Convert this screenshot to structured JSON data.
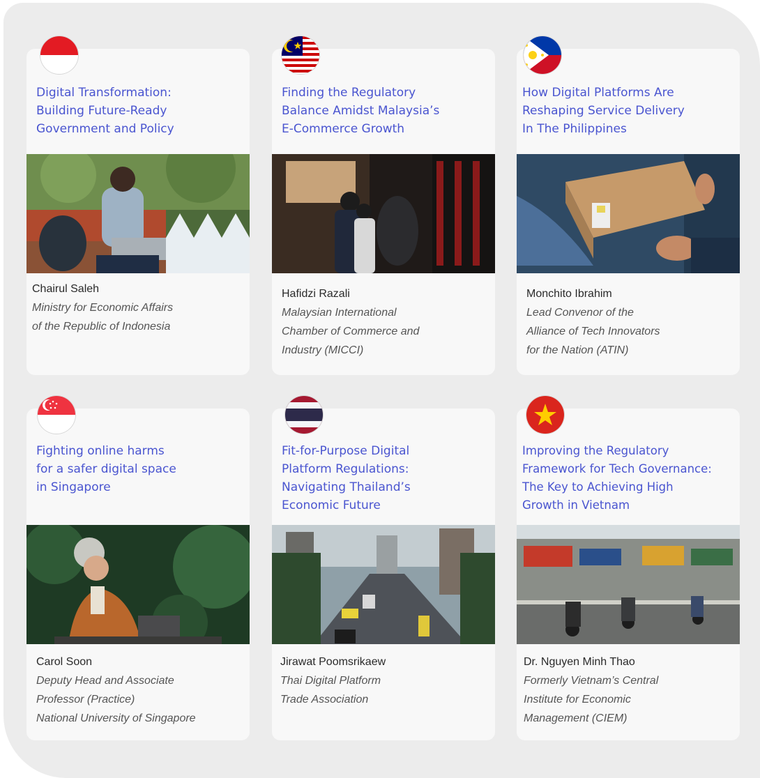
{
  "cards": [
    {
      "country": "Indonesia",
      "flag_icon": "indonesia-flag-icon",
      "title_lines": [
        "Digital Transformation:",
        "Building Future-Ready",
        "Government and Policy"
      ],
      "name": "Chairul Saleh",
      "affiliation_lines": [
        "Ministry for Economic Affairs",
        "of the Republic of Indonesia"
      ]
    },
    {
      "country": "Malaysia",
      "flag_icon": "malaysia-flag-icon",
      "title_lines": [
        "Finding the Regulatory",
        "Balance Amidst Malaysia’s",
        "E-Commerce Growth"
      ],
      "name": "Hafidzi Razali",
      "affiliation_lines": [
        "Malaysian International",
        "Chamber of Commerce and",
        "Industry (MICCI)"
      ]
    },
    {
      "country": "Philippines",
      "flag_icon": "philippines-flag-icon",
      "title_lines": [
        "How Digital Platforms Are",
        "Reshaping Service Delivery",
        "In The Philippines"
      ],
      "name": "Monchito Ibrahim",
      "affiliation_lines": [
        "Lead Convenor of the",
        "Alliance of Tech Innovators",
        "for the Nation (ATIN)"
      ]
    },
    {
      "country": "Singapore",
      "flag_icon": "singapore-flag-icon",
      "title_lines": [
        "Fighting online harms",
        "for a safer digital space",
        "in Singapore"
      ],
      "name": "Carol Soon",
      "affiliation_lines": [
        "Deputy Head and Associate",
        "Professor (Practice)",
        "National University of Singapore"
      ]
    },
    {
      "country": "Thailand",
      "flag_icon": "thailand-flag-icon",
      "title_lines": [
        "Fit-for-Purpose Digital",
        "Platform Regulations:",
        "Navigating Thailand’s",
        "Economic Future"
      ],
      "name": "Jirawat Poomsrikaew",
      "affiliation_lines": [
        "Thai Digital Platform",
        "Trade Association"
      ]
    },
    {
      "country": "Vietnam",
      "flag_icon": "vietnam-flag-icon",
      "title_lines": [
        "Improving the Regulatory",
        "Framework for Tech Governance:",
        "The Key to Achieving High",
        "Growth in Vietnam"
      ],
      "name": "Dr. Nguyen Minh Thao",
      "affiliation_lines": [
        "Formerly Vietnam’s Central",
        "Institute for Economic",
        "Management (CIEM)"
      ]
    }
  ],
  "colors": {
    "title": "#4a55d0",
    "panel": "#ececec",
    "card": "#f8f8f8"
  }
}
